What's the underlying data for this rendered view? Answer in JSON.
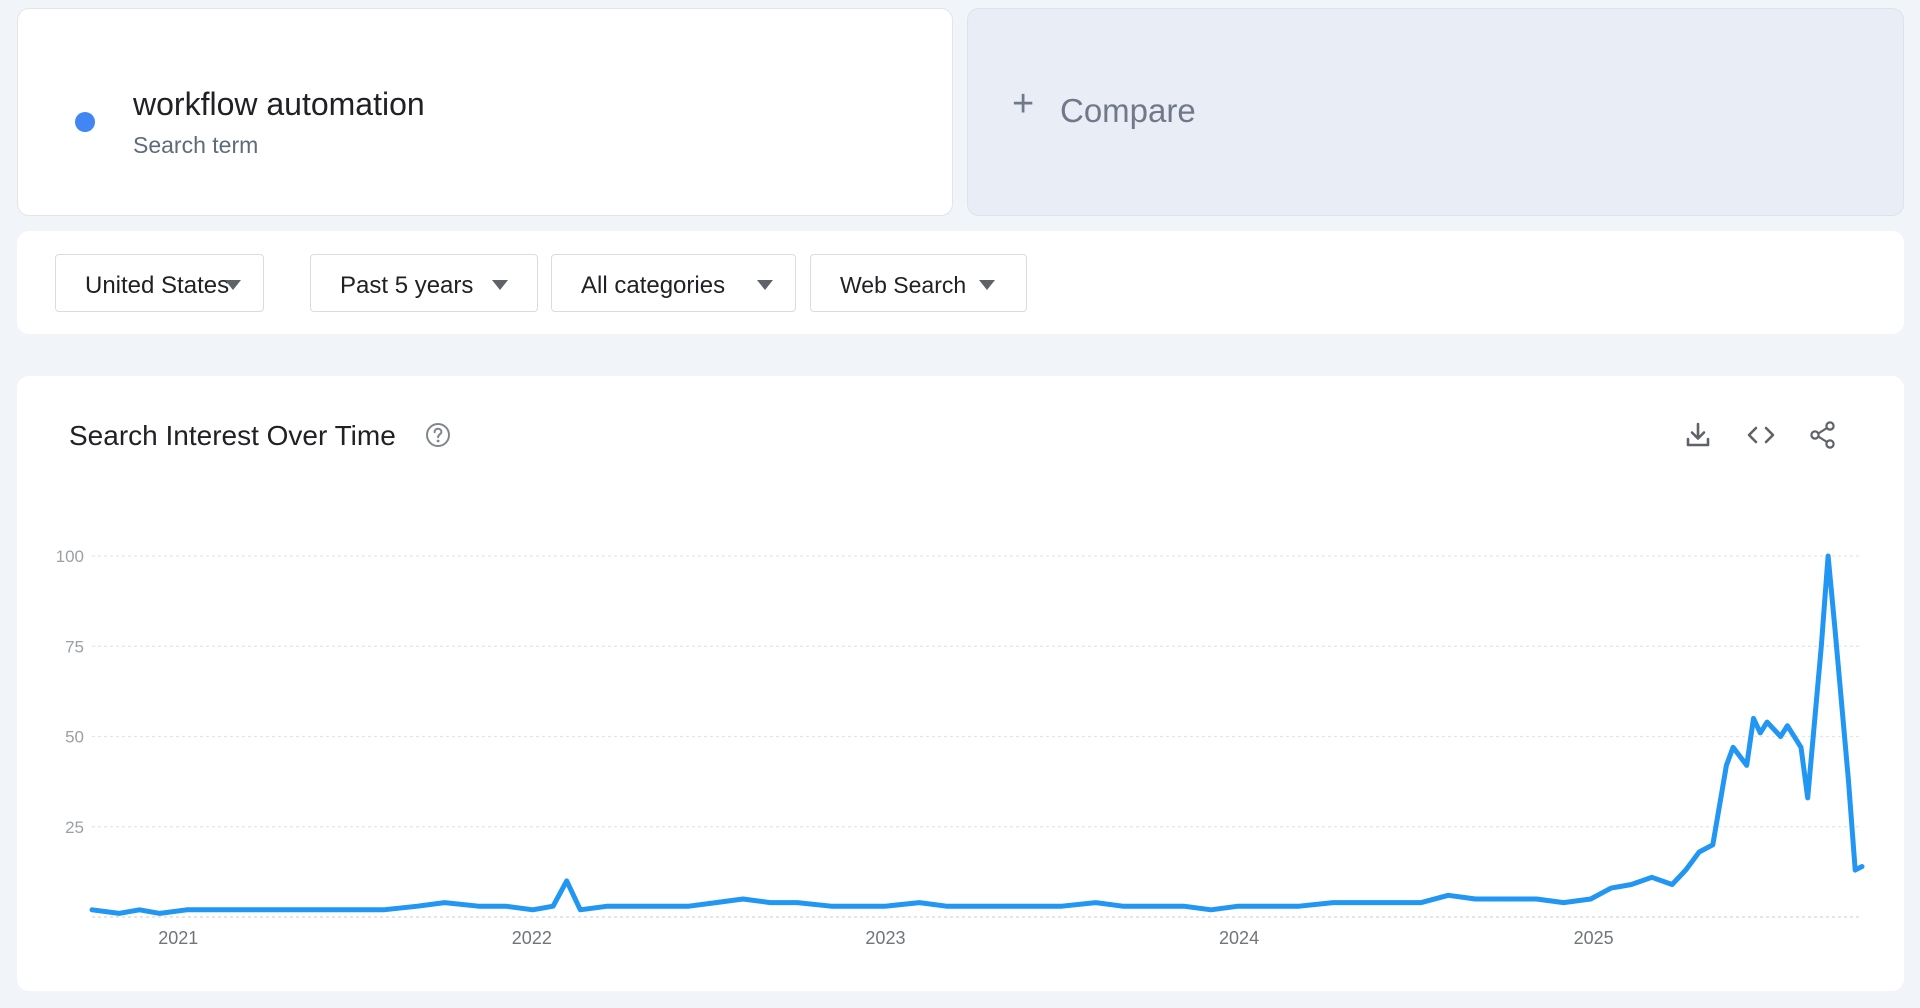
{
  "term": {
    "name": "workflow automation",
    "type": "Search term",
    "color": "#4285f4"
  },
  "compare": {
    "icon": "plus-icon",
    "label": "Compare"
  },
  "filters": {
    "region": "United States",
    "time": "Past 5 years",
    "category": "All categories",
    "search_type": "Web Search"
  },
  "chart_panel": {
    "title": "Search Interest Over Time",
    "icons": [
      "help-icon",
      "download-icon",
      "embed-code-icon",
      "share-icon"
    ]
  },
  "chart_data": {
    "type": "line",
    "title": "Search Interest Over Time",
    "xlabel": "",
    "ylabel": "",
    "ylim": [
      0,
      100
    ],
    "xlim": [
      "2020-10-04",
      "2025-10-05"
    ],
    "grid": true,
    "y_ticks": [
      "100",
      "75",
      "50",
      "25"
    ],
    "x_ticks": [
      "2021",
      "2022",
      "2023",
      "2024",
      "2025"
    ],
    "series": [
      {
        "name": "workflow automation",
        "color": "#2196f3",
        "points": [
          [
            "2020-10-04",
            2
          ],
          [
            "2020-11-01",
            1
          ],
          [
            "2020-11-22",
            2
          ],
          [
            "2020-12-13",
            1
          ],
          [
            "2021-01-10",
            2
          ],
          [
            "2021-02-07",
            2
          ],
          [
            "2021-03-07",
            2
          ],
          [
            "2021-04-04",
            2
          ],
          [
            "2021-05-02",
            2
          ],
          [
            "2021-06-06",
            2
          ],
          [
            "2021-07-04",
            2
          ],
          [
            "2021-08-01",
            2
          ],
          [
            "2021-09-05",
            3
          ],
          [
            "2021-10-03",
            4
          ],
          [
            "2021-11-07",
            3
          ],
          [
            "2021-12-05",
            3
          ],
          [
            "2022-01-02",
            2
          ],
          [
            "2022-01-23",
            3
          ],
          [
            "2022-02-06",
            10
          ],
          [
            "2022-02-20",
            2
          ],
          [
            "2022-03-20",
            3
          ],
          [
            "2022-04-17",
            3
          ],
          [
            "2022-05-15",
            3
          ],
          [
            "2022-06-12",
            3
          ],
          [
            "2022-07-10",
            4
          ],
          [
            "2022-08-07",
            5
          ],
          [
            "2022-09-04",
            4
          ],
          [
            "2022-10-02",
            4
          ],
          [
            "2022-11-06",
            3
          ],
          [
            "2022-12-04",
            3
          ],
          [
            "2023-01-01",
            3
          ],
          [
            "2023-02-05",
            4
          ],
          [
            "2023-03-05",
            3
          ],
          [
            "2023-04-02",
            3
          ],
          [
            "2023-05-07",
            3
          ],
          [
            "2023-06-04",
            3
          ],
          [
            "2023-07-02",
            3
          ],
          [
            "2023-08-06",
            4
          ],
          [
            "2023-09-03",
            3
          ],
          [
            "2023-10-01",
            3
          ],
          [
            "2023-11-05",
            3
          ],
          [
            "2023-12-03",
            2
          ],
          [
            "2023-12-31",
            3
          ],
          [
            "2024-02-04",
            3
          ],
          [
            "2024-03-03",
            3
          ],
          [
            "2024-04-07",
            4
          ],
          [
            "2024-05-05",
            4
          ],
          [
            "2024-06-02",
            4
          ],
          [
            "2024-07-07",
            4
          ],
          [
            "2024-08-04",
            6
          ],
          [
            "2024-09-01",
            5
          ],
          [
            "2024-10-06",
            5
          ],
          [
            "2024-11-03",
            5
          ],
          [
            "2024-12-01",
            4
          ],
          [
            "2024-12-29",
            5
          ],
          [
            "2025-01-19",
            8
          ],
          [
            "2025-02-09",
            9
          ],
          [
            "2025-03-02",
            11
          ],
          [
            "2025-03-23",
            9
          ],
          [
            "2025-04-06",
            13
          ],
          [
            "2025-04-20",
            18
          ],
          [
            "2025-05-04",
            20
          ],
          [
            "2025-05-18",
            42
          ],
          [
            "2025-05-25",
            47
          ],
          [
            "2025-06-08",
            42
          ],
          [
            "2025-06-15",
            55
          ],
          [
            "2025-06-22",
            51
          ],
          [
            "2025-06-29",
            54
          ],
          [
            "2025-07-13",
            50
          ],
          [
            "2025-07-20",
            53
          ],
          [
            "2025-08-03",
            47
          ],
          [
            "2025-08-10",
            33
          ],
          [
            "2025-08-24",
            75
          ],
          [
            "2025-08-31",
            100
          ],
          [
            "2025-09-07",
            80
          ],
          [
            "2025-09-21",
            38
          ],
          [
            "2025-09-28",
            13
          ],
          [
            "2025-10-05",
            14
          ]
        ]
      }
    ]
  }
}
